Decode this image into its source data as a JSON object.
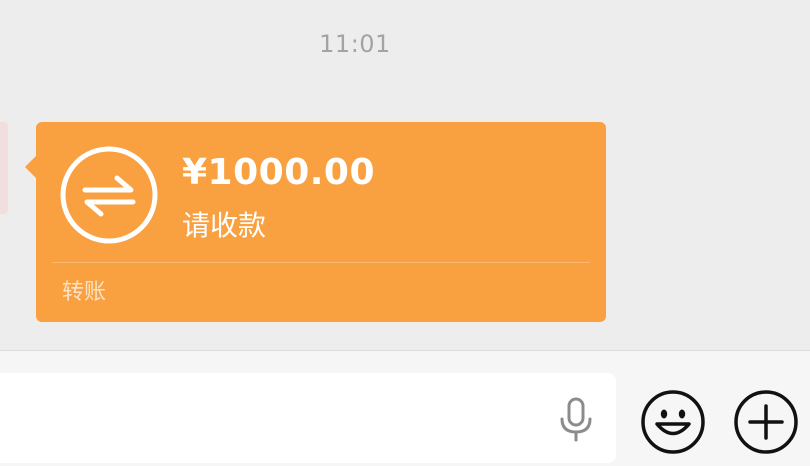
{
  "chat": {
    "timestamp": "11:01"
  },
  "transfer": {
    "amount": "¥1000.00",
    "status": "请收款",
    "label": "转账",
    "card_color": "#f9a040",
    "icon": "transfer-arrows-icon"
  },
  "input_bar": {
    "text_value": "",
    "placeholder": "",
    "voice_icon": "microphone-icon",
    "emoji_icon": "smiley-icon",
    "more_icon": "plus-circle-icon"
  }
}
